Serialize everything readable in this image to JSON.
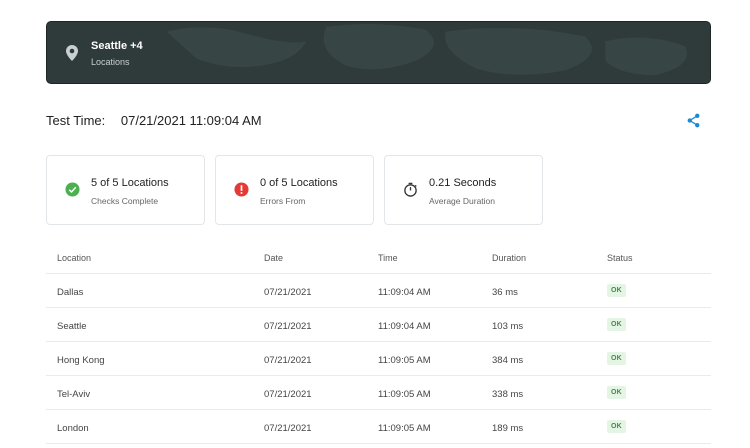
{
  "banner": {
    "title": "Seattle +4",
    "subtitle": "Locations",
    "icon": "map-pin-icon"
  },
  "test_time": {
    "label": "Test Time:",
    "value": "07/21/2021 11:09:04 AM"
  },
  "share": {
    "icon": "share-icon",
    "color": "#1a88d6"
  },
  "cards": [
    {
      "icon": "check-circle-icon",
      "main": "5 of 5 Locations",
      "sub": "Checks Complete",
      "color": "#4caf50"
    },
    {
      "icon": "error-circle-icon",
      "main": "0 of 5 Locations",
      "sub": "Errors From",
      "color": "#e53935"
    },
    {
      "icon": "stopwatch-icon",
      "main": "0.21 Seconds",
      "sub": "Average Duration",
      "color": "#333333"
    }
  ],
  "table": {
    "headers": [
      "Location",
      "Date",
      "Time",
      "Duration",
      "Status"
    ],
    "rows": [
      {
        "location": "Dallas",
        "date": "07/21/2021",
        "time": "11:09:04 AM",
        "duration": "36 ms",
        "status": "OK"
      },
      {
        "location": "Seattle",
        "date": "07/21/2021",
        "time": "11:09:04 AM",
        "duration": "103 ms",
        "status": "OK"
      },
      {
        "location": "Hong Kong",
        "date": "07/21/2021",
        "time": "11:09:05 AM",
        "duration": "384 ms",
        "status": "OK"
      },
      {
        "location": "Tel-Aviv",
        "date": "07/21/2021",
        "time": "11:09:05 AM",
        "duration": "338 ms",
        "status": "OK"
      },
      {
        "location": "London",
        "date": "07/21/2021",
        "time": "11:09:05 AM",
        "duration": "189 ms",
        "status": "OK"
      }
    ]
  }
}
